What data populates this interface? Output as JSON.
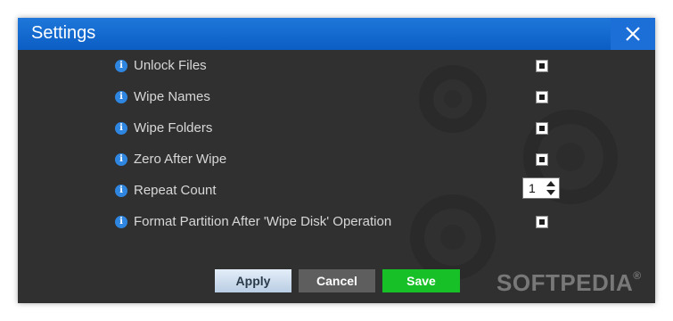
{
  "window": {
    "title": "Settings",
    "close_icon": "close-icon"
  },
  "settings": [
    {
      "label": "Unlock Files",
      "control": "checkbox",
      "checked": true
    },
    {
      "label": "Wipe Names",
      "control": "checkbox",
      "checked": true
    },
    {
      "label": "Wipe Folders",
      "control": "checkbox",
      "checked": true
    },
    {
      "label": "Zero After Wipe",
      "control": "checkbox",
      "checked": true
    },
    {
      "label": "Repeat Count",
      "control": "spinner",
      "value": "1"
    },
    {
      "label": "Format Partition After 'Wipe Disk' Operation",
      "control": "checkbox",
      "checked": true
    }
  ],
  "buttons": {
    "apply": "Apply",
    "cancel": "Cancel",
    "save": "Save"
  },
  "watermark": {
    "text": "SOFTPEDIA",
    "mark": "®"
  },
  "colors": {
    "titlebar": "#1f77da",
    "background": "#303030",
    "save": "#16c026",
    "info_icon": "#2f86e0"
  }
}
